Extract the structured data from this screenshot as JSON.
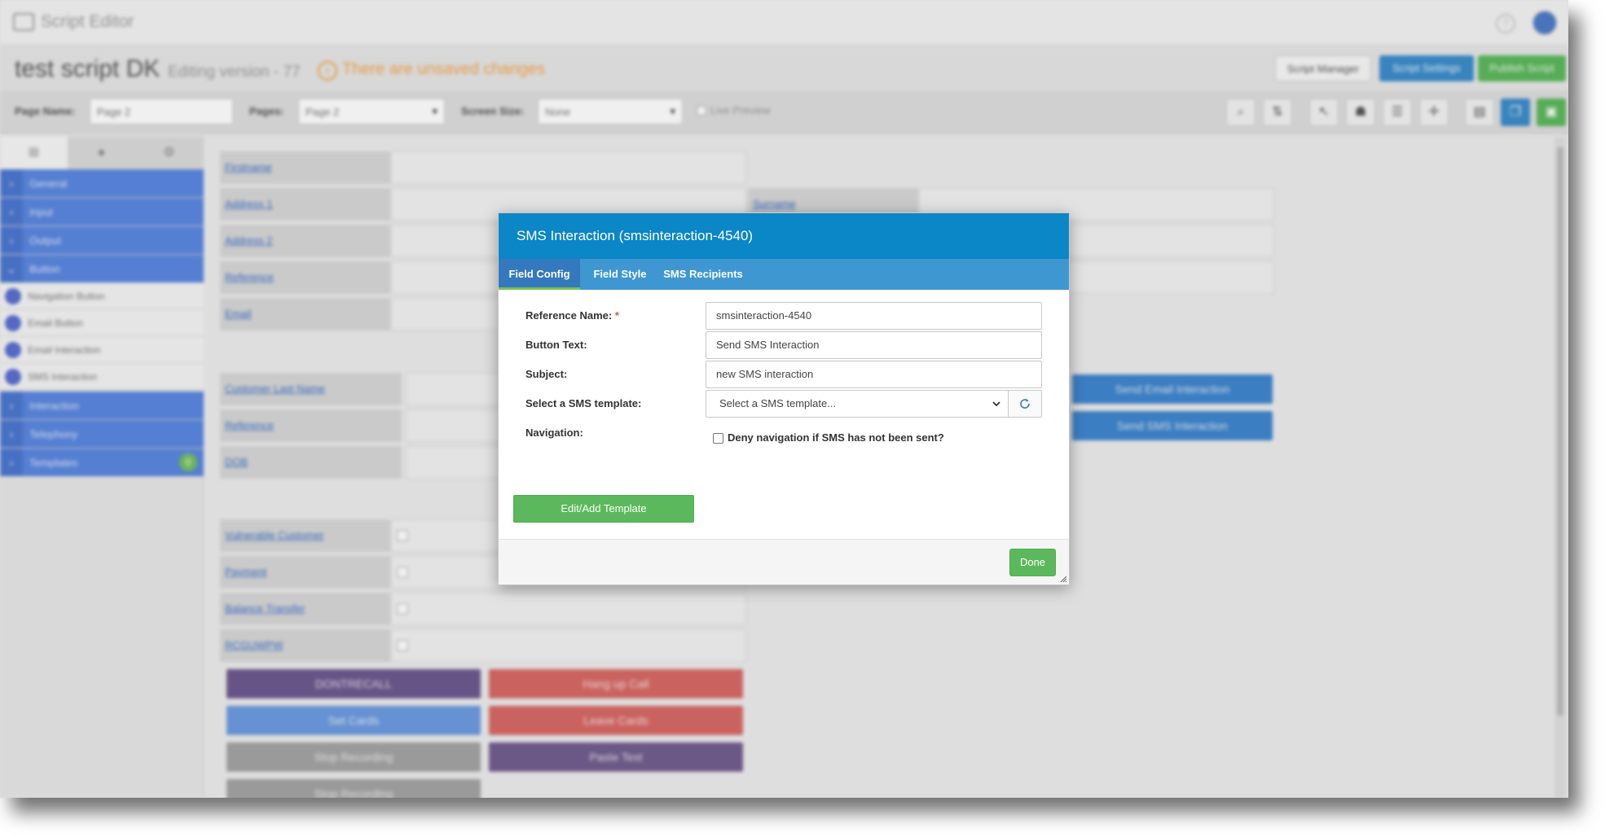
{
  "app": {
    "title": "Script Editor",
    "help_icon": "question-circle-icon",
    "avatar_icon": "user-avatar-icon"
  },
  "header": {
    "script_name": "test script DK",
    "version_label": "Editing version - 77",
    "unsaved_label": "There are unsaved changes",
    "buttons": {
      "manager": "Script Manager",
      "settings": "Script Settings",
      "publish": "Publish Script"
    }
  },
  "toolbar": {
    "page_name_label": "Page Name:",
    "page_name_value": "Page 2",
    "pages_label": "Pages:",
    "pages_value": "Page 2",
    "screen_size_label": "Screen Size:",
    "screen_size_value": "None",
    "live_preview_label": "Live Preview"
  },
  "sidebar": {
    "categories": [
      {
        "label": "General"
      },
      {
        "label": "Input"
      },
      {
        "label": "Output"
      },
      {
        "label": "Button"
      }
    ],
    "button_items": [
      {
        "label": "Navigation Button"
      },
      {
        "label": "Email Button"
      },
      {
        "label": "Email Interaction"
      },
      {
        "label": "SMS Interaction"
      }
    ],
    "more_categories": [
      {
        "label": "Interaction"
      },
      {
        "label": "Telephony"
      },
      {
        "label": "Templates",
        "badge": "0"
      }
    ]
  },
  "canvas": {
    "fields_left": [
      {
        "label": "Firstname"
      },
      {
        "label": "Address 1"
      },
      {
        "label": "Address 2"
      },
      {
        "label": "Reference"
      },
      {
        "label": "Email"
      }
    ],
    "fields_right": [
      {
        "label": "Surname"
      }
    ],
    "fields_mid": [
      {
        "label": "Customer Last Name"
      },
      {
        "label": "Reference"
      },
      {
        "label": "DOB"
      }
    ],
    "checkbox_fields": [
      {
        "label": "Vulnerable Customer"
      },
      {
        "label": "Payment"
      },
      {
        "label": "Balance Transfer"
      },
      {
        "label": "RCGUWPW"
      }
    ],
    "send_buttons": {
      "email": "Send Email Interaction",
      "sms": "Send SMS Interaction"
    },
    "action_buttons": {
      "do_not_recall": "DONTRECALL",
      "hang_up": "Hang up Call",
      "set_cards": "Set Cards",
      "leave_cards": "Leave Cards",
      "stop_recording": "Stop Recording",
      "paste_text": "Paste Text",
      "stop_recording_2": "Stop Recording"
    }
  },
  "modal": {
    "title": "SMS Interaction (smsinteraction-4540)",
    "tabs": {
      "field_config": "Field Config",
      "field_style": "Field Style",
      "sms_recipients": "SMS Recipients"
    },
    "reference_name_label": "Reference Name:",
    "required_marker": "*",
    "reference_name_value": "smsinteraction-4540",
    "button_text_label": "Button Text:",
    "button_text_value": "Send SMS Interaction",
    "subject_label": "Subject:",
    "subject_value": "new SMS interaction",
    "template_label": "Select a SMS template:",
    "template_placeholder": "Select a SMS template...",
    "navigation_label": "Navigation:",
    "deny_navigation_label": "Deny navigation if SMS has not been sent?",
    "edit_template_button": "Edit/Add Template",
    "done_button": "Done"
  }
}
